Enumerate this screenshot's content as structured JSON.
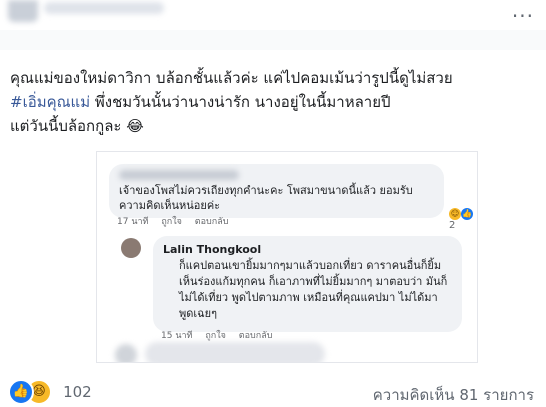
{
  "header": {
    "more_icon": "more-horizontal-icon",
    "more_label": "···"
  },
  "post": {
    "line1": "คุณแม่ของใหม่ดาวิกา บล้อกชั้นแล้วค่ะ แค่ไปคอมเม้นว่ารูปนี้ดูไม่สวย",
    "hashtag": "#เอิ่มคุณแม่",
    "line2_rest": " พึ่งชมวันนั้นว่านางน่ารัก นางอยู่ในนี้มาหลายปี",
    "line3": "แต่วันนี้บล้อกกูละ 😂"
  },
  "embed": {
    "comment1": {
      "text": "เจ้าของโพสไม่ควรเถียงทุกคำนะคะ โพสมาขนาดนี้แล้ว ยอมรับความคิดเห็นหน่อยค่ะ",
      "time": "17 นาที",
      "like": "ถูกใจ",
      "reply": "ตอบกลับ",
      "reaction_count": "2"
    },
    "comment2": {
      "author": "Lalin Thongkool",
      "text": "ก็แคปตอนเขายิ้มมากๆมาแล้วบอกเที่ยว ดาราคนอื่นก็ยิ้มเห็นร่องแก้มทุกคน ก็เอาภาพที่ไม่ยิ้มมากๆ มาตอบว่า มันก็ไม่ได้เที่ยว พูดไปตามภาพ เหมือนที่คุณแคปมา ไม่ได้มาพูดเฉยๆ",
      "time": "15 นาที",
      "like": "ถูกใจ",
      "reply": "ตอบกลับ"
    }
  },
  "footer": {
    "reaction_count": "102",
    "comments_label": "ความคิดเห็น 81 รายการ",
    "reaction_icons": [
      "like-icon",
      "haha-icon"
    ]
  }
}
